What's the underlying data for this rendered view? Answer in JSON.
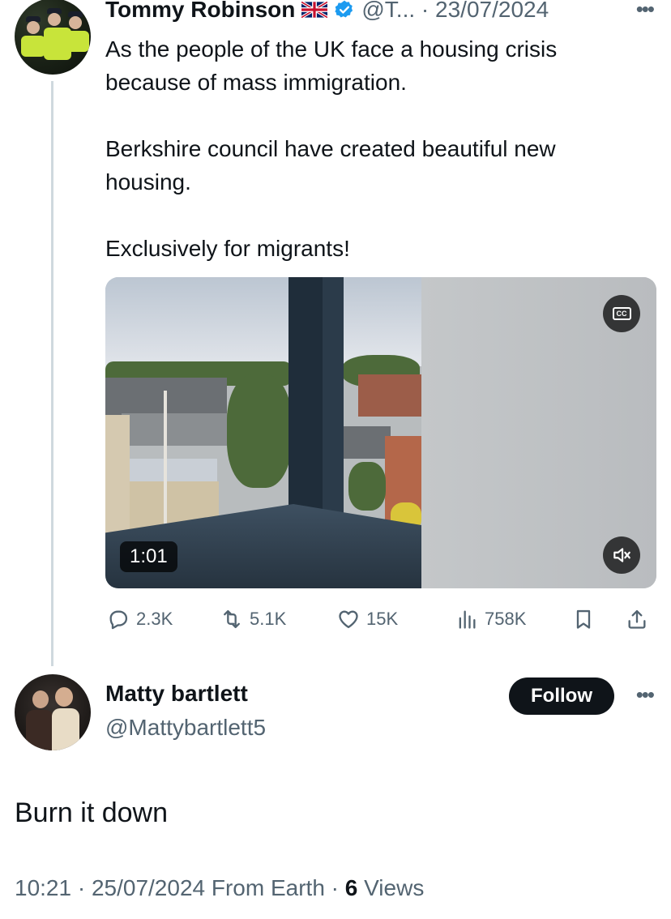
{
  "parent_tweet": {
    "author_name": "Tommy Robinson",
    "flag_icon": "uk-flag-icon",
    "verified_icon": "verified-badge-icon",
    "handle_and_date": "@T... · 23/07/2024",
    "more_icon": "more-horizontal-icon",
    "paragraphs": [
      "As the people of the UK face a housing crisis because of mass immigration.",
      "Berkshire council have created beautiful new housing.",
      "Exclusively for migrants!"
    ],
    "video": {
      "duration": "1:01",
      "cc_label": "CC",
      "mute_icon": "speaker-muted-icon"
    },
    "actions": {
      "replies": "2.3K",
      "reposts": "5.1K",
      "likes": "15K",
      "views": "758K"
    }
  },
  "reply": {
    "author_name": "Matty bartlett",
    "handle": "@Mattybartlett5",
    "follow_label": "Follow",
    "text": "Burn it down",
    "meta_prefix": "10:21 · 25/07/2024 From Earth · ",
    "views_count": "6",
    "views_suffix": " Views"
  },
  "colors": {
    "text": "#0f1419",
    "secondary": "#536471",
    "verified": "#1d9bf0",
    "thread_line": "#cfd9de"
  }
}
